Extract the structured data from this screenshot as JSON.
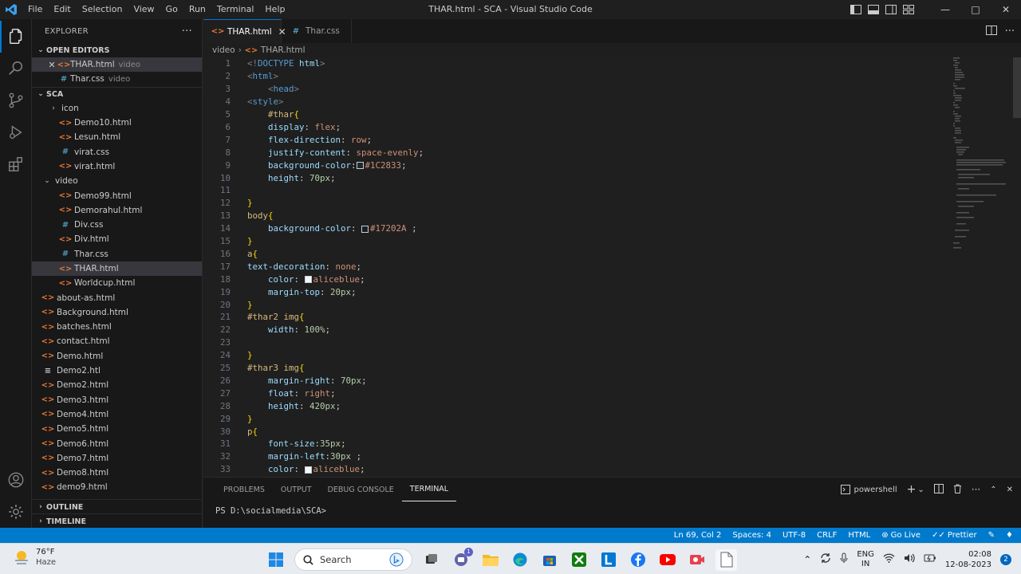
{
  "titlebar": {
    "menu": [
      "File",
      "Edit",
      "Selection",
      "View",
      "Go",
      "Run",
      "Terminal",
      "Help"
    ],
    "window_title": "THAR.html - SCA - Visual Studio Code",
    "window_controls": [
      "minimize-icon",
      "maximize-icon",
      "close-icon"
    ]
  },
  "sidebar": {
    "header": "EXPLORER",
    "open_editors": {
      "title": "OPEN EDITORS",
      "items": [
        {
          "name": "THAR.html",
          "hint": "video",
          "type": "html"
        },
        {
          "name": "Thar.css",
          "hint": "video",
          "type": "css"
        }
      ]
    },
    "workspace": {
      "title": "SCA",
      "items": [
        {
          "name": "icon",
          "type": "folder",
          "depth": 1,
          "expanded": false
        },
        {
          "name": "Demo10.html",
          "type": "html",
          "depth": 1
        },
        {
          "name": "Lesun.html",
          "type": "html",
          "depth": 1
        },
        {
          "name": "virat.css",
          "type": "css",
          "depth": 1
        },
        {
          "name": "virat.html",
          "type": "html",
          "depth": 1
        },
        {
          "name": "video",
          "type": "folder",
          "depth": 0,
          "expanded": true
        },
        {
          "name": "Demo99.html",
          "type": "html",
          "depth": 1
        },
        {
          "name": "Demorahul.html",
          "type": "html",
          "depth": 1
        },
        {
          "name": "Div.css",
          "type": "css",
          "depth": 1
        },
        {
          "name": "Div.html",
          "type": "html",
          "depth": 1
        },
        {
          "name": "Thar.css",
          "type": "css",
          "depth": 1
        },
        {
          "name": "THAR.html",
          "type": "html",
          "depth": 1,
          "selected": true
        },
        {
          "name": "Worldcup.html",
          "type": "html",
          "depth": 1
        },
        {
          "name": "about-as.html",
          "type": "html",
          "depth": 0
        },
        {
          "name": "Background.html",
          "type": "html",
          "depth": 0
        },
        {
          "name": "batches.html",
          "type": "html",
          "depth": 0
        },
        {
          "name": "contact.html",
          "type": "html",
          "depth": 0
        },
        {
          "name": "Demo.html",
          "type": "html",
          "depth": 0
        },
        {
          "name": "Demo2.htl",
          "type": "txt",
          "depth": 0
        },
        {
          "name": "Demo2.html",
          "type": "html",
          "depth": 0
        },
        {
          "name": "Demo3.html",
          "type": "html",
          "depth": 0
        },
        {
          "name": "Demo4.html",
          "type": "html",
          "depth": 0
        },
        {
          "name": "Demo5.html",
          "type": "html",
          "depth": 0
        },
        {
          "name": "Demo6.html",
          "type": "html",
          "depth": 0
        },
        {
          "name": "Demo7.html",
          "type": "html",
          "depth": 0
        },
        {
          "name": "Demo8.html",
          "type": "html",
          "depth": 0
        },
        {
          "name": "demo9.html",
          "type": "html",
          "depth": 0
        }
      ]
    },
    "outline": "OUTLINE",
    "timeline": "TIMELINE"
  },
  "tabs": [
    {
      "label": "THAR.html",
      "type": "html",
      "active": true
    },
    {
      "label": "Thar.css",
      "type": "css",
      "active": false
    }
  ],
  "breadcrumb": [
    "video",
    "THAR.html"
  ],
  "editor": {
    "lines": [
      [
        [
          "c-bracket",
          "<!"
        ],
        [
          "c-tag",
          "DOCTYPE"
        ],
        [
          "c-prop",
          " html"
        ],
        [
          "c-bracket",
          ">"
        ]
      ],
      [
        [
          "c-bracket",
          "<"
        ],
        [
          "c-tag",
          "html"
        ],
        [
          "c-bracket",
          ">"
        ]
      ],
      [
        [
          "c-punct",
          "    "
        ],
        [
          "c-bracket",
          "<"
        ],
        [
          "c-tag",
          "head"
        ],
        [
          "c-bracket",
          ">"
        ]
      ],
      [
        [
          "c-bracket",
          "<"
        ],
        [
          "c-tag",
          "style"
        ],
        [
          "c-bracket",
          ">"
        ]
      ],
      [
        [
          "c-punct",
          "    "
        ],
        [
          "c-sel",
          "#thar"
        ],
        [
          "c-brace",
          "{"
        ]
      ],
      [
        [
          "c-punct",
          "    "
        ],
        [
          "c-prop",
          "display"
        ],
        [
          "c-punct",
          ": "
        ],
        [
          "c-val",
          "flex"
        ],
        [
          "c-punct",
          ";"
        ]
      ],
      [
        [
          "c-punct",
          "    "
        ],
        [
          "c-prop",
          "flex-direction"
        ],
        [
          "c-punct",
          ": "
        ],
        [
          "c-val",
          "row"
        ],
        [
          "c-punct",
          ";"
        ]
      ],
      [
        [
          "c-punct",
          "    "
        ],
        [
          "c-prop",
          "justify-content"
        ],
        [
          "c-punct",
          ": "
        ],
        [
          "c-val",
          "space-evenly"
        ],
        [
          "c-punct",
          ";"
        ]
      ],
      [
        [
          "c-punct",
          "    "
        ],
        [
          "c-prop",
          "background-color"
        ],
        [
          "c-punct",
          ":"
        ],
        [
          "swatch",
          "#1C2833"
        ],
        [
          "c-val",
          "#1C2833"
        ],
        [
          "c-punct",
          ";"
        ]
      ],
      [
        [
          "c-punct",
          "    "
        ],
        [
          "c-prop",
          "height"
        ],
        [
          "c-punct",
          ": "
        ],
        [
          "c-num",
          "70px"
        ],
        [
          "c-punct",
          ";"
        ]
      ],
      [],
      [
        [
          "c-brace",
          "}"
        ]
      ],
      [
        [
          "c-sel",
          "body"
        ],
        [
          "c-brace",
          "{"
        ]
      ],
      [
        [
          "c-punct",
          "    "
        ],
        [
          "c-prop",
          "background-color"
        ],
        [
          "c-punct",
          ": "
        ],
        [
          "swatch",
          "#17202A"
        ],
        [
          "c-val",
          "#17202A"
        ],
        [
          "c-punct",
          " ;"
        ]
      ],
      [
        [
          "c-brace",
          "}"
        ]
      ],
      [
        [
          "c-sel",
          "a"
        ],
        [
          "c-brace",
          "{"
        ]
      ],
      [
        [
          "c-prop",
          "text-decoration"
        ],
        [
          "c-punct",
          ": "
        ],
        [
          "c-val",
          "none"
        ],
        [
          "c-punct",
          ";"
        ]
      ],
      [
        [
          "c-punct",
          "    "
        ],
        [
          "c-prop",
          "color"
        ],
        [
          "c-punct",
          ": "
        ],
        [
          "swatch",
          "#f0f8ff"
        ],
        [
          "c-val",
          "aliceblue"
        ],
        [
          "c-punct",
          ";"
        ]
      ],
      [
        [
          "c-punct",
          "    "
        ],
        [
          "c-prop",
          "margin-top"
        ],
        [
          "c-punct",
          ": "
        ],
        [
          "c-num",
          "20px"
        ],
        [
          "c-punct",
          ";"
        ]
      ],
      [
        [
          "c-brace",
          "}"
        ]
      ],
      [
        [
          "c-sel",
          "#thar2 img"
        ],
        [
          "c-brace",
          "{"
        ]
      ],
      [
        [
          "c-punct",
          "    "
        ],
        [
          "c-prop",
          "width"
        ],
        [
          "c-punct",
          ": "
        ],
        [
          "c-num",
          "100%"
        ],
        [
          "c-punct",
          ";"
        ]
      ],
      [],
      [
        [
          "c-brace",
          "}"
        ]
      ],
      [
        [
          "c-sel",
          "#thar3 img"
        ],
        [
          "c-brace",
          "{"
        ]
      ],
      [
        [
          "c-punct",
          "    "
        ],
        [
          "c-prop",
          "margin-right"
        ],
        [
          "c-punct",
          ": "
        ],
        [
          "c-num",
          "70px"
        ],
        [
          "c-punct",
          ";"
        ]
      ],
      [
        [
          "c-punct",
          "    "
        ],
        [
          "c-prop",
          "float"
        ],
        [
          "c-punct",
          ": "
        ],
        [
          "c-val",
          "right"
        ],
        [
          "c-punct",
          ";"
        ]
      ],
      [
        [
          "c-punct",
          "    "
        ],
        [
          "c-prop",
          "height"
        ],
        [
          "c-punct",
          ": "
        ],
        [
          "c-num",
          "420px"
        ],
        [
          "c-punct",
          ";"
        ]
      ],
      [
        [
          "c-brace",
          "}"
        ]
      ],
      [
        [
          "c-sel",
          "p"
        ],
        [
          "c-brace",
          "{"
        ]
      ],
      [
        [
          "c-punct",
          "    "
        ],
        [
          "c-prop",
          "font-size"
        ],
        [
          "c-punct",
          ":"
        ],
        [
          "c-num",
          "35px"
        ],
        [
          "c-punct",
          ";"
        ]
      ],
      [
        [
          "c-punct",
          "    "
        ],
        [
          "c-prop",
          "margin-left"
        ],
        [
          "c-punct",
          ":"
        ],
        [
          "c-num",
          "30px"
        ],
        [
          "c-punct",
          " ;"
        ]
      ],
      [
        [
          "c-punct",
          "    "
        ],
        [
          "c-prop",
          "color"
        ],
        [
          "c-punct",
          ": "
        ],
        [
          "swatch",
          "#f0f8ff"
        ],
        [
          "c-val",
          "aliceblue"
        ],
        [
          "c-punct",
          ";"
        ]
      ]
    ]
  },
  "panel": {
    "tabs": [
      "PROBLEMS",
      "OUTPUT",
      "DEBUG CONSOLE",
      "TERMINAL"
    ],
    "active_tab": "TERMINAL",
    "terminal_name": "powershell",
    "prompt": "PS D:\\socialmedia\\SCA>"
  },
  "statusbar": {
    "items": [
      "Ln 69, Col 2",
      "Spaces: 4",
      "UTF-8",
      "CRLF",
      "HTML",
      "Go Live",
      "Prettier"
    ]
  },
  "taskbar": {
    "weather_temp": "76°F",
    "weather_desc": "Haze",
    "search_placeholder": "Search",
    "lang_top": "ENG",
    "lang_bottom": "IN",
    "time": "02:08",
    "date": "12-08-2023",
    "notification_count": "2",
    "teams_badge": "1"
  },
  "colors": {
    "accent": "#0078d4",
    "statusbar": "#007acc",
    "html_icon": "#e37933",
    "css_icon": "#519aba"
  }
}
